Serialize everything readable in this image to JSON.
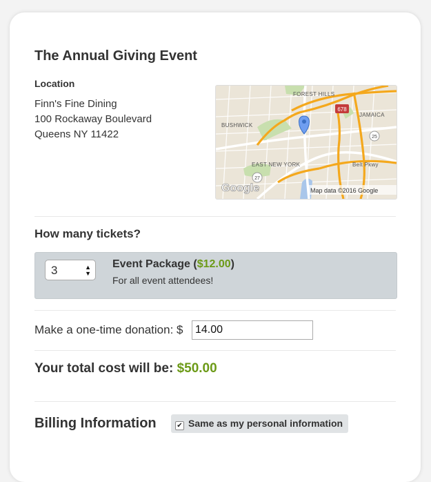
{
  "event": {
    "title": "The Annual Giving Event"
  },
  "location": {
    "label": "Location",
    "venue": "Finn's Fine Dining",
    "street": "100 Rockaway Boulevard",
    "city": "Queens NY 11422"
  },
  "map": {
    "labels": {
      "forest_hills": "FOREST HILLS",
      "bushwick": "BUSHWICK",
      "jamaica": "JAMAICA",
      "east_new_york": "EAST NEW YORK",
      "belt_pkwy": "Belt Pkwy",
      "shield_678": "678",
      "shield_25": "25",
      "shield_27": "27",
      "logo": "Google",
      "attribution": "Map data ©2016 Google"
    },
    "pin_icon": "map-pin-icon"
  },
  "tickets": {
    "question": "How many tickets?",
    "quantity": "3",
    "package_name": "Event Package (",
    "package_price": "$12.00",
    "package_close": ")",
    "package_desc": "For all event attendees!"
  },
  "donation": {
    "label": "Make a one-time donation: $",
    "value": "14.00"
  },
  "total": {
    "label": "Your total cost will be: ",
    "value": "$50.00"
  },
  "billing": {
    "title": "Billing Information",
    "same_label": "Same as my personal information",
    "same_checked": true
  },
  "colors": {
    "accent_green": "#6c9a17",
    "package_bg": "#cfd5d9"
  }
}
